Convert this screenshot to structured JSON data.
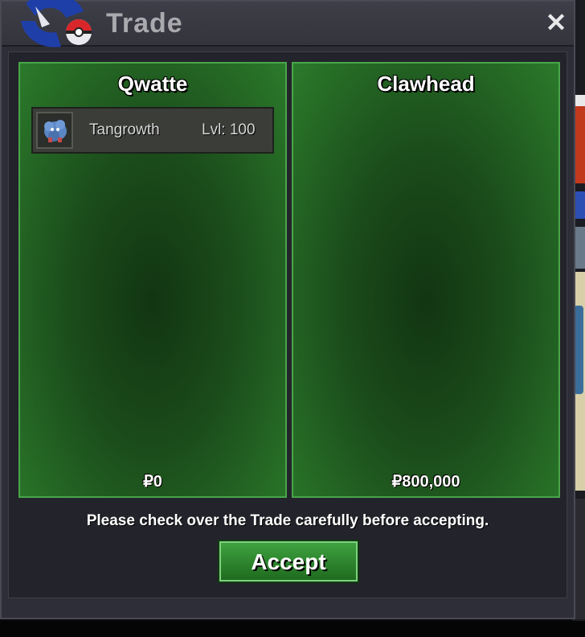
{
  "window": {
    "title": "Trade",
    "close_symbol": "✕"
  },
  "left_panel": {
    "player_name": "Qwatte",
    "items": [
      {
        "icon": "tangrowth-sprite-icon",
        "name": "Tangrowth",
        "level": "Lvl: 100"
      }
    ],
    "money": "₽0"
  },
  "right_panel": {
    "player_name": "Clawhead",
    "items": [],
    "money": "₽800,000"
  },
  "notice": "Please check over the Trade carefully before accepting.",
  "accept_label": "Accept",
  "colors": {
    "panel_green": "#1b4c1b",
    "panel_border": "#49a549",
    "window_bg": "#2e2e38",
    "title_text": "#a9a9ae"
  }
}
